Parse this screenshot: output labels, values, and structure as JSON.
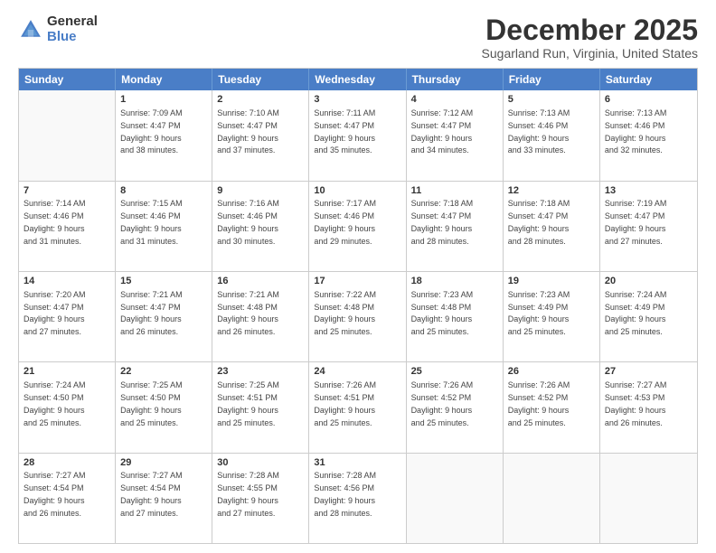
{
  "logo": {
    "general": "General",
    "blue": "Blue"
  },
  "title": "December 2025",
  "subtitle": "Sugarland Run, Virginia, United States",
  "header_days": [
    "Sunday",
    "Monday",
    "Tuesday",
    "Wednesday",
    "Thursday",
    "Friday",
    "Saturday"
  ],
  "weeks": [
    [
      {
        "day": "",
        "info": ""
      },
      {
        "day": "1",
        "info": "Sunrise: 7:09 AM\nSunset: 4:47 PM\nDaylight: 9 hours\nand 38 minutes."
      },
      {
        "day": "2",
        "info": "Sunrise: 7:10 AM\nSunset: 4:47 PM\nDaylight: 9 hours\nand 37 minutes."
      },
      {
        "day": "3",
        "info": "Sunrise: 7:11 AM\nSunset: 4:47 PM\nDaylight: 9 hours\nand 35 minutes."
      },
      {
        "day": "4",
        "info": "Sunrise: 7:12 AM\nSunset: 4:47 PM\nDaylight: 9 hours\nand 34 minutes."
      },
      {
        "day": "5",
        "info": "Sunrise: 7:13 AM\nSunset: 4:46 PM\nDaylight: 9 hours\nand 33 minutes."
      },
      {
        "day": "6",
        "info": "Sunrise: 7:13 AM\nSunset: 4:46 PM\nDaylight: 9 hours\nand 32 minutes."
      }
    ],
    [
      {
        "day": "7",
        "info": "Sunrise: 7:14 AM\nSunset: 4:46 PM\nDaylight: 9 hours\nand 31 minutes."
      },
      {
        "day": "8",
        "info": "Sunrise: 7:15 AM\nSunset: 4:46 PM\nDaylight: 9 hours\nand 31 minutes."
      },
      {
        "day": "9",
        "info": "Sunrise: 7:16 AM\nSunset: 4:46 PM\nDaylight: 9 hours\nand 30 minutes."
      },
      {
        "day": "10",
        "info": "Sunrise: 7:17 AM\nSunset: 4:46 PM\nDaylight: 9 hours\nand 29 minutes."
      },
      {
        "day": "11",
        "info": "Sunrise: 7:18 AM\nSunset: 4:47 PM\nDaylight: 9 hours\nand 28 minutes."
      },
      {
        "day": "12",
        "info": "Sunrise: 7:18 AM\nSunset: 4:47 PM\nDaylight: 9 hours\nand 28 minutes."
      },
      {
        "day": "13",
        "info": "Sunrise: 7:19 AM\nSunset: 4:47 PM\nDaylight: 9 hours\nand 27 minutes."
      }
    ],
    [
      {
        "day": "14",
        "info": "Sunrise: 7:20 AM\nSunset: 4:47 PM\nDaylight: 9 hours\nand 27 minutes."
      },
      {
        "day": "15",
        "info": "Sunrise: 7:21 AM\nSunset: 4:47 PM\nDaylight: 9 hours\nand 26 minutes."
      },
      {
        "day": "16",
        "info": "Sunrise: 7:21 AM\nSunset: 4:48 PM\nDaylight: 9 hours\nand 26 minutes."
      },
      {
        "day": "17",
        "info": "Sunrise: 7:22 AM\nSunset: 4:48 PM\nDaylight: 9 hours\nand 25 minutes."
      },
      {
        "day": "18",
        "info": "Sunrise: 7:23 AM\nSunset: 4:48 PM\nDaylight: 9 hours\nand 25 minutes."
      },
      {
        "day": "19",
        "info": "Sunrise: 7:23 AM\nSunset: 4:49 PM\nDaylight: 9 hours\nand 25 minutes."
      },
      {
        "day": "20",
        "info": "Sunrise: 7:24 AM\nSunset: 4:49 PM\nDaylight: 9 hours\nand 25 minutes."
      }
    ],
    [
      {
        "day": "21",
        "info": "Sunrise: 7:24 AM\nSunset: 4:50 PM\nDaylight: 9 hours\nand 25 minutes."
      },
      {
        "day": "22",
        "info": "Sunrise: 7:25 AM\nSunset: 4:50 PM\nDaylight: 9 hours\nand 25 minutes."
      },
      {
        "day": "23",
        "info": "Sunrise: 7:25 AM\nSunset: 4:51 PM\nDaylight: 9 hours\nand 25 minutes."
      },
      {
        "day": "24",
        "info": "Sunrise: 7:26 AM\nSunset: 4:51 PM\nDaylight: 9 hours\nand 25 minutes."
      },
      {
        "day": "25",
        "info": "Sunrise: 7:26 AM\nSunset: 4:52 PM\nDaylight: 9 hours\nand 25 minutes."
      },
      {
        "day": "26",
        "info": "Sunrise: 7:26 AM\nSunset: 4:52 PM\nDaylight: 9 hours\nand 25 minutes."
      },
      {
        "day": "27",
        "info": "Sunrise: 7:27 AM\nSunset: 4:53 PM\nDaylight: 9 hours\nand 26 minutes."
      }
    ],
    [
      {
        "day": "28",
        "info": "Sunrise: 7:27 AM\nSunset: 4:54 PM\nDaylight: 9 hours\nand 26 minutes."
      },
      {
        "day": "29",
        "info": "Sunrise: 7:27 AM\nSunset: 4:54 PM\nDaylight: 9 hours\nand 27 minutes."
      },
      {
        "day": "30",
        "info": "Sunrise: 7:28 AM\nSunset: 4:55 PM\nDaylight: 9 hours\nand 27 minutes."
      },
      {
        "day": "31",
        "info": "Sunrise: 7:28 AM\nSunset: 4:56 PM\nDaylight: 9 hours\nand 28 minutes."
      },
      {
        "day": "",
        "info": ""
      },
      {
        "day": "",
        "info": ""
      },
      {
        "day": "",
        "info": ""
      }
    ]
  ]
}
